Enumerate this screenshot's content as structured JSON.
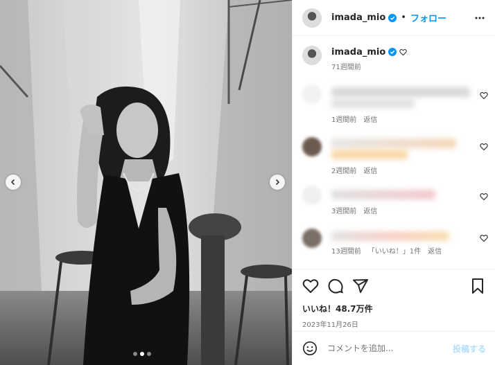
{
  "post": {
    "username": "imada_mio",
    "follow_label": "フォロー",
    "separator": "•",
    "caption_time": "71週間前",
    "likes": "いいね！48.7万件",
    "date": "2023年11月26日",
    "comment_placeholder": "コメントを追加...",
    "post_label": "投稿する"
  },
  "comments": [
    {
      "time": "1週間前",
      "reply": "返信",
      "likes_label": ""
    },
    {
      "time": "2週間前",
      "reply": "返信",
      "likes_label": ""
    },
    {
      "time": "3週間前",
      "reply": "返信",
      "likes_label": ""
    },
    {
      "time": "13週間前",
      "reply": "返信",
      "likes_label": "「いいね！」1件"
    }
  ],
  "colors": {
    "accent": "#0095f6",
    "verified": "#0095f6",
    "muted_text": "#737373"
  },
  "icons": [
    "more-options-icon",
    "verified-badge-icon",
    "heart-icon",
    "comment-icon",
    "share-icon",
    "bookmark-icon",
    "emoji-icon",
    "chevron-left-icon",
    "chevron-right-icon"
  ],
  "carousel": {
    "slides": 3,
    "active_index": 1
  }
}
